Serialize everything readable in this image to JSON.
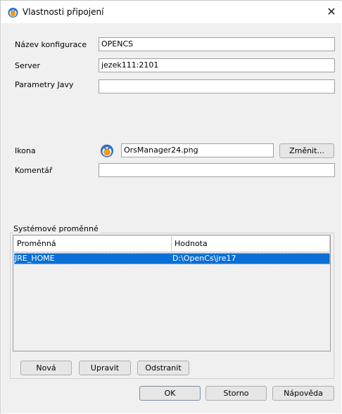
{
  "window": {
    "title": "Vlastnosti připojení"
  },
  "form": {
    "nazev": {
      "label": "Název konfigurace",
      "value": "OPENCS"
    },
    "server": {
      "label": "Server",
      "value": "jezek111:2101"
    },
    "parametry": {
      "label": "Parametry Javy",
      "value": ""
    },
    "ikona": {
      "label": "Ikona",
      "value": "OrsManager24.png",
      "button": "Změnit..."
    },
    "komentar": {
      "label": "Komentář",
      "value": ""
    }
  },
  "variables": {
    "group_label": "Systémové proměnné",
    "columns": [
      "Proměnná",
      "Hodnota"
    ],
    "rows": [
      {
        "name": "JRE_HOME",
        "value": "D:\\OpenCs\\jre17",
        "selected": true
      }
    ],
    "buttons": {
      "new": "Nová",
      "edit": "Upravit",
      "remove": "Odstranit"
    }
  },
  "footer": {
    "ok": "OK",
    "cancel": "Storno",
    "help": "Nápověda"
  },
  "colors": {
    "selection": "#0a6fd6",
    "logo_outer": "#2f72c4",
    "logo_inner": "#f39a1d"
  },
  "icons": {
    "app": "ors-logo-icon",
    "close": "close-icon"
  }
}
